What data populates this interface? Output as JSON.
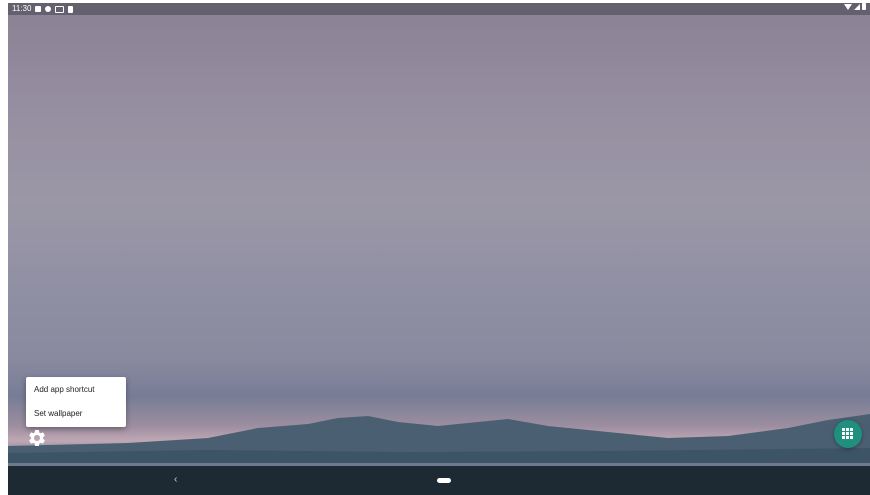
{
  "status_bar": {
    "time": "11:30",
    "left_icons": [
      "notification-icon",
      "settings-icon",
      "cast-icon",
      "sd-card-icon"
    ],
    "right_icons": [
      "wifi-icon",
      "signal-icon",
      "battery-icon"
    ]
  },
  "context_menu": {
    "items": [
      {
        "label": "Add app shortcut"
      },
      {
        "label": "Set wallpaper"
      }
    ]
  },
  "home": {
    "settings_icon": "gear-icon",
    "app_drawer_icon": "apps-grid-icon",
    "app_drawer_color": "#1f8f7e"
  },
  "nav_bar": {
    "back_glyph": "‹",
    "home_icon": "home-pill-icon",
    "background": "#1e2a33"
  }
}
